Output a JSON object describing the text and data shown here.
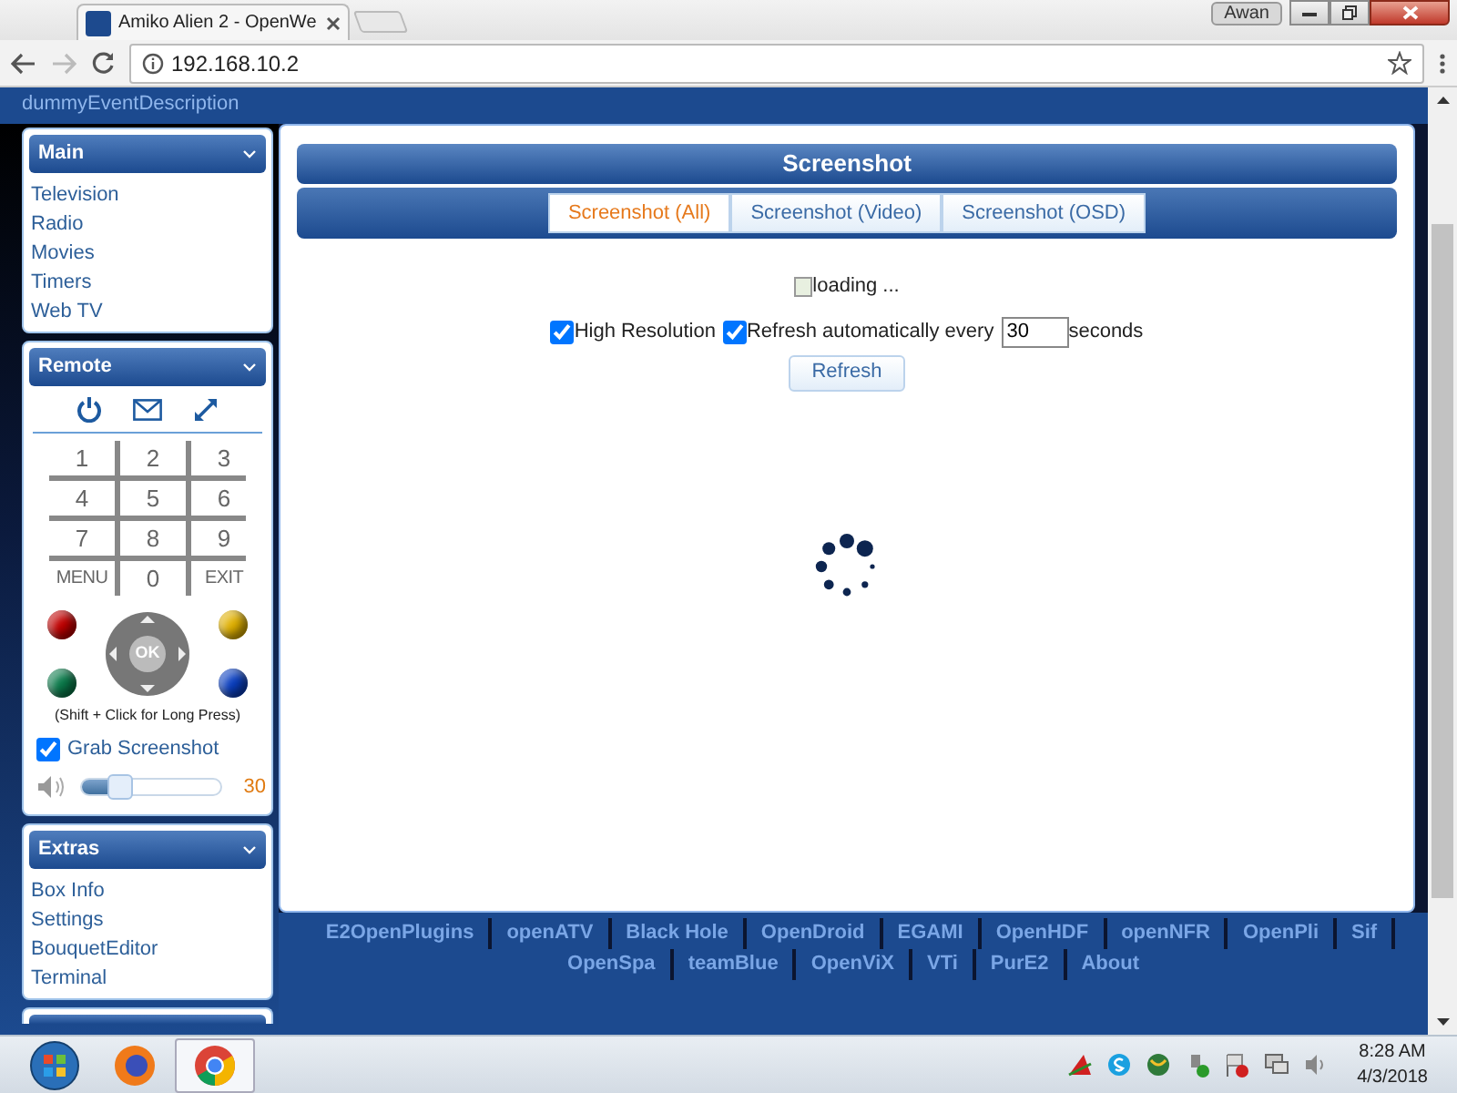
{
  "browser": {
    "tab_title": "Amiko Alien 2 - OpenWe",
    "url": "192.168.10.2",
    "profile": "Awan"
  },
  "header": {
    "event_description": "dummyEventDescription"
  },
  "sidebar": {
    "main": {
      "title": "Main",
      "items": [
        "Television",
        "Radio",
        "Movies",
        "Timers",
        "Web TV"
      ]
    },
    "remote": {
      "title": "Remote",
      "keys": [
        "1",
        "2",
        "3",
        "4",
        "5",
        "6",
        "7",
        "8",
        "9",
        "MENU",
        "0",
        "EXIT"
      ],
      "color_keys": [
        {
          "color": "#c00000"
        },
        {
          "color": "#0a7a4a"
        },
        {
          "color": "#e0b000"
        },
        {
          "color": "#0a3fc0"
        }
      ],
      "ok_label": "OK",
      "hint": "(Shift + Click for Long Press)",
      "grab_screenshot": {
        "label": "Grab Screenshot",
        "checked": true
      },
      "volume": {
        "level": 0.28,
        "reading": "30"
      }
    },
    "extras": {
      "title": "Extras",
      "items": [
        "Box Info",
        "Settings",
        "BouquetEditor",
        "Terminal"
      ]
    }
  },
  "screenshot": {
    "title": "Screenshot",
    "tabs": [
      {
        "label": "Screenshot (All)",
        "selected": true
      },
      {
        "label": "Screenshot (Video)",
        "selected": false
      },
      {
        "label": "Screenshot (OSD)",
        "selected": false
      }
    ],
    "image_alt": "loading ...",
    "high_resolution": {
      "label": "High Resolution",
      "checked": true
    },
    "auto_refresh": {
      "label": "Refresh automatically every",
      "checked": true,
      "value": "30",
      "suffix": "seconds"
    },
    "refresh_button": "Refresh"
  },
  "footer_links": [
    [
      "E2OpenPlugins",
      "openATV",
      "Black Hole",
      "OpenDroid",
      "EGAMI",
      "OpenHDF",
      "openNFR",
      "OpenPli",
      "Sif"
    ],
    [
      "OpenSpa",
      "teamBlue",
      "OpenViX",
      "VTi",
      "PurE2",
      "About"
    ]
  ],
  "taskbar": {
    "time": "8:28 AM",
    "date": "4/3/2018"
  }
}
